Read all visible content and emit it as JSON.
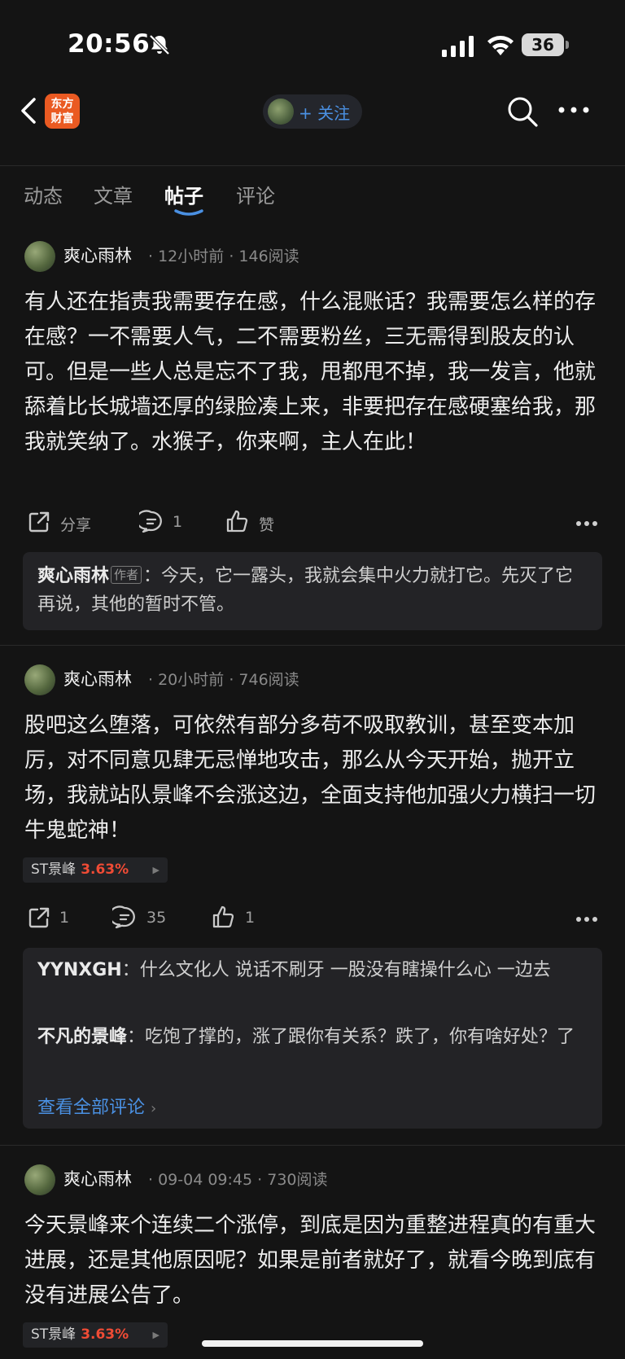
{
  "status_bar": {
    "time": "20:56",
    "battery": "36"
  },
  "nav": {
    "logo_line1": "东方",
    "logo_line2": "财富",
    "follow_label": "+ 关注"
  },
  "tabs": [
    "动态",
    "文章",
    "帖子",
    "评论"
  ],
  "active_tab": "帖子",
  "posts": [
    {
      "author": "爽心雨林",
      "time": "12小时前",
      "reads": "146阅读",
      "content": "有人还在指责我需要存在感，什么混账话？我需要怎么样的存在感？一不需要人气，二不需要粉丝，三无需得到股友的认可。但是一些人总是忘不了我，甩都甩不掉，我一发言，他就舔着比长城墙还厚的绿脸凑上来，非要把存在感硬塞给我，那我就笑纳了。水猴子，你来啊，主人在此！",
      "share_label": "分享",
      "comment_count": "1",
      "like_label": "赞",
      "comments": [
        {
          "name": "爽心雨林",
          "badge": "作者",
          "text": "：今天，它一露头，我就会集中火力就打它。先灭了它再说，其他的暂时不管。"
        }
      ]
    },
    {
      "author": "爽心雨林",
      "time": "20小时前",
      "reads": "746阅读",
      "content": "股吧这么堕落，可依然有部分多苟不吸取教训，甚至变本加厉，对不同意见肆无忌惮地攻击，那么从今天开始，抛开立场，我就站队景峰不会涨这边，全面支持他加强火力横扫一切牛鬼蛇神！",
      "stock": {
        "name": "ST景峰",
        "change": "3.63%"
      },
      "share_count": "1",
      "comment_count": "35",
      "like_count": "1",
      "comments": [
        {
          "name": "YYNXGH",
          "text": "：什么文化人 说话不刷牙 一股没有瞎操什么心 一边去"
        },
        {
          "name": "不凡的景峰",
          "text": "：吃饱了撑的，涨了跟你有关系？跌了，你有啥好处？了"
        }
      ],
      "view_all": "查看全部评论"
    },
    {
      "author": "爽心雨林",
      "time": "09-04 09:45",
      "reads": "730阅读",
      "content": "今天景峰来个连续二个涨停，到底是因为重整进程真的有重大进展，还是其他原因呢？如果是前者就好了，就看今晚到底有没有进展公告了。",
      "stock": {
        "name": "ST景峰",
        "change": "3.63%"
      }
    }
  ],
  "colors": {
    "background": "#141414",
    "accent_blue": "#4a90e2",
    "up_red": "#ef4b35",
    "logo_orange": "#ea5a22"
  }
}
